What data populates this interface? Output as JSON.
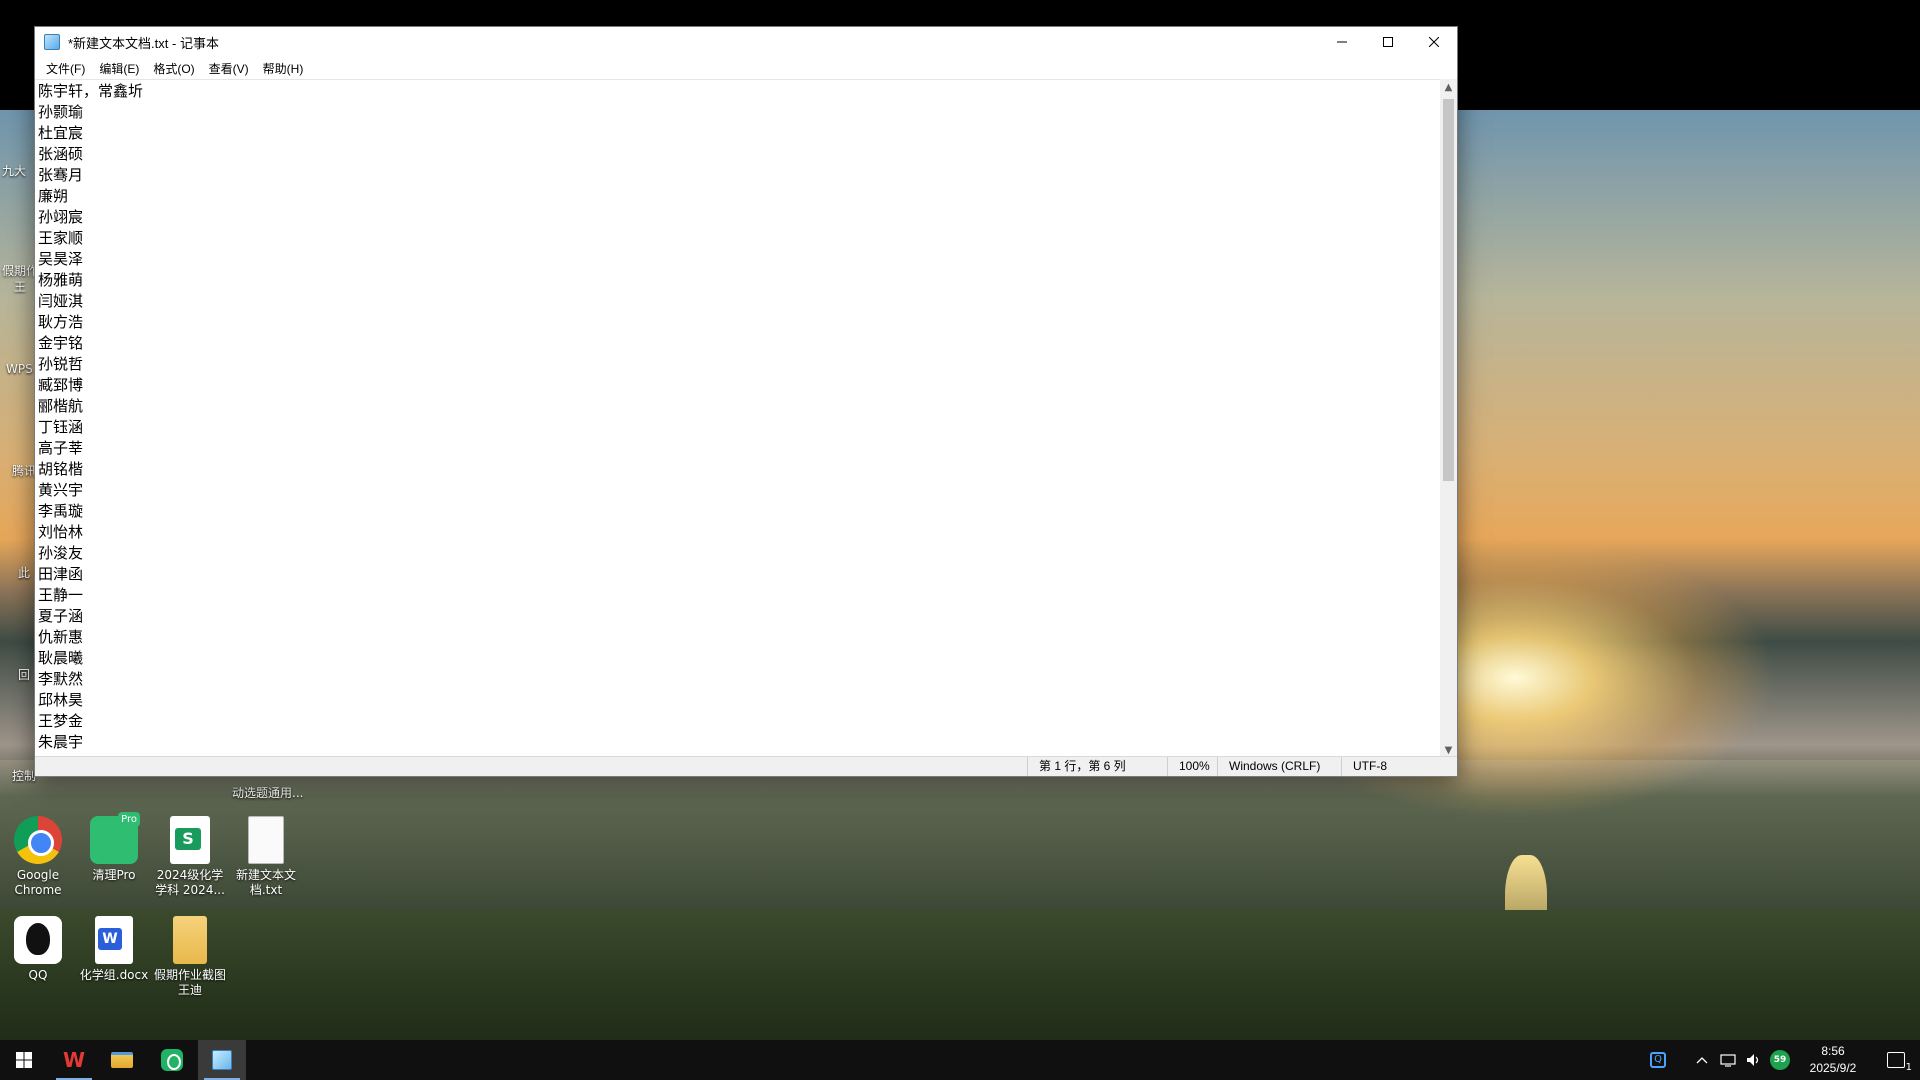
{
  "notepad": {
    "title": "*新建文本文档.txt - 记事本",
    "menu": [
      "文件(F)",
      "编辑(E)",
      "格式(O)",
      "查看(V)",
      "帮助(H)"
    ],
    "lines": [
      "陈宇轩，常鑫圻",
      "孙颢瑜",
      "杜宜宸",
      "张涵硕",
      "张骞月",
      "廉朔",
      "孙翊宸",
      "王家顺",
      "吴昊泽",
      "杨雅萌",
      "闫娅淇",
      "耿方浩",
      "金宇铭",
      "孙锐哲",
      "臧郅博",
      "郦楷航",
      "丁钰涵",
      "高子莘",
      "胡铭楷",
      "黄兴宇",
      "李禹璇",
      "刘怡林",
      "孙浚友",
      "田津函",
      "王静一",
      "夏子涵",
      "仇新惠",
      "耿晨曦",
      "李默然",
      "邱林昊",
      "王梦金",
      "朱晨宇"
    ],
    "status": {
      "position": "第 1 行，第 6 列",
      "zoom": "100%",
      "line_ending": "Windows (CRLF)",
      "encoding": "UTF-8"
    }
  },
  "desktop": {
    "partial_labels": {
      "jiuda": "九大",
      "jiaqi": "假期作",
      "wang": "王",
      "wps": "WPS",
      "tengxun": "腾讯",
      "ci": "此",
      "hui": "回",
      "kongzhi": "控制",
      "dongxuan": "动选题通用..."
    },
    "icons": [
      {
        "label": "Google\nChrome"
      },
      {
        "label": "清理Pro"
      },
      {
        "label": "2024级化学\n学科  2024..."
      },
      {
        "label": "新建文本文\n档.txt"
      },
      {
        "label": "QQ"
      },
      {
        "label": "化学组.docx"
      },
      {
        "label": "假期作业截图\n王迪"
      }
    ]
  },
  "taskbar": {
    "tray_badge": "59",
    "time": "8:56",
    "date": "2025/9/2",
    "notification_count": "1"
  }
}
